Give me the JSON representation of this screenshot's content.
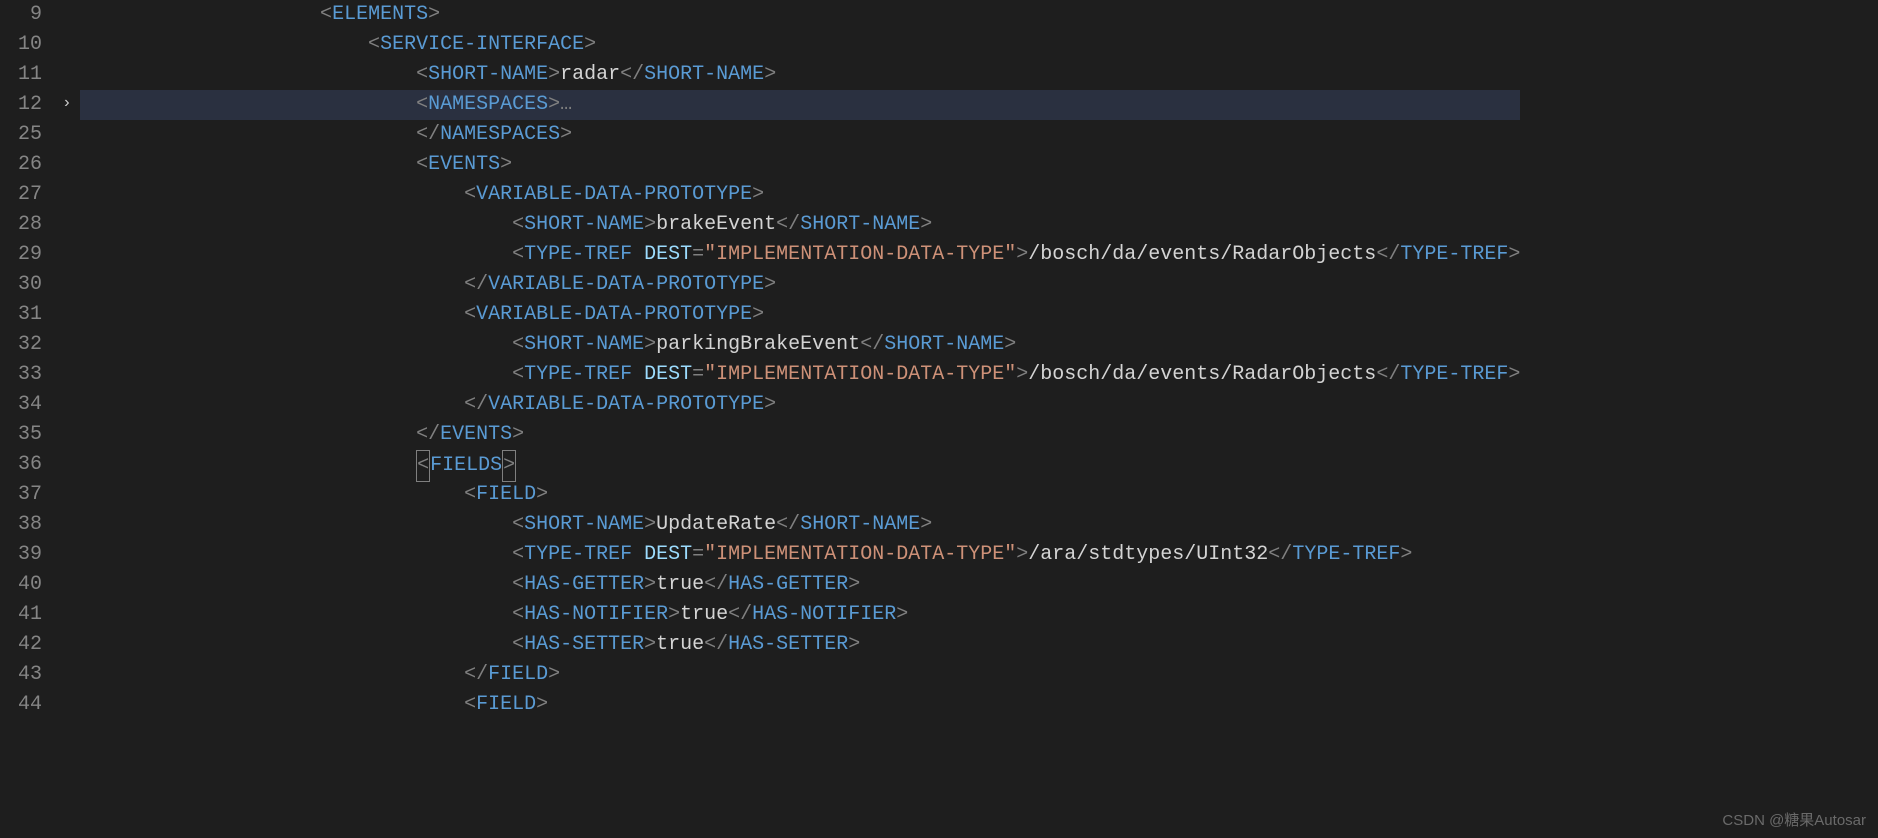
{
  "line_numbers": [
    "9",
    "10",
    "11",
    "12",
    "25",
    "26",
    "27",
    "28",
    "29",
    "30",
    "31",
    "32",
    "33",
    "34",
    "35",
    "36",
    "37",
    "38",
    "39",
    "40",
    "41",
    "42",
    "43",
    "44"
  ],
  "highlighted_line_index": 3,
  "fold_arrow_line_index": 3,
  "tags": {
    "elements": "ELEMENTS",
    "service_interface": "SERVICE-INTERFACE",
    "short_name": "SHORT-NAME",
    "namespaces": "NAMESPACES",
    "events": "EVENTS",
    "variable_data_prototype": "VARIABLE-DATA-PROTOTYPE",
    "type_tref": "TYPE-TREF",
    "fields": "FIELDS",
    "field": "FIELD",
    "has_getter": "HAS-GETTER",
    "has_notifier": "HAS-NOTIFIER",
    "has_setter": "HAS-SETTER"
  },
  "attrs": {
    "dest": "DEST",
    "dest_value": "\"IMPLEMENTATION-DATA-TYPE\""
  },
  "values": {
    "radar": "radar",
    "brake_event": "brakeEvent",
    "parking_brake_event": "parkingBrakeEvent",
    "update_rate": "UpdateRate",
    "radar_objects_path": "/bosch/da/events/RadarObjects",
    "uint32_path": "/ara/stdtypes/UInt32",
    "true_val": "true",
    "ellipsis": "…"
  },
  "watermark": "CSDN @糖果Autosar"
}
